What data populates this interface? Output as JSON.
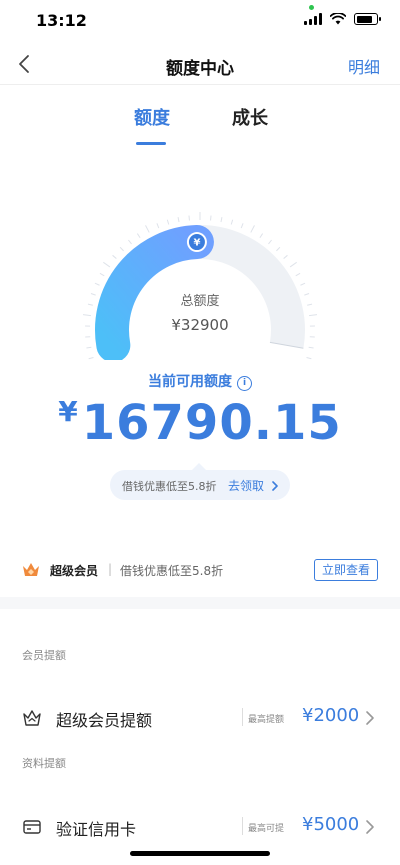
{
  "status": {
    "time": "13:12",
    "battery_level": 0.85
  },
  "nav": {
    "title": "额度中心",
    "right": "明细"
  },
  "tabs": [
    {
      "label": "额度",
      "active": true
    },
    {
      "label": "成长",
      "active": false
    }
  ],
  "gauge": {
    "total_label": "总额度",
    "total_value": "¥32900",
    "used_fraction": 0.49,
    "badge": "¥"
  },
  "available": {
    "label": "当前可用额度",
    "info_icon": "i",
    "currency": "¥",
    "amount": "16790.15"
  },
  "promo": {
    "text": "借钱优惠低至5.8折",
    "link": "去领取"
  },
  "vip": {
    "title": "超级会员",
    "sep": "|",
    "desc": "借钱优惠低至5.8折",
    "button": "立即查看"
  },
  "sections": [
    {
      "label": "会员提额",
      "items": [
        {
          "icon": "crown-icon",
          "title": "超级会员提额",
          "hint": "最高提额",
          "value": "¥2000"
        }
      ]
    },
    {
      "label": "资料提额",
      "items": [
        {
          "icon": "credit-card-icon",
          "title": "验证信用卡",
          "hint": "最高可提",
          "value": "¥5000"
        }
      ]
    }
  ],
  "colors": {
    "accent": "#3b7ddd",
    "gauge_start": "#4dbff8",
    "gauge_end": "#6fa0ff",
    "track": "#eef1f5"
  }
}
